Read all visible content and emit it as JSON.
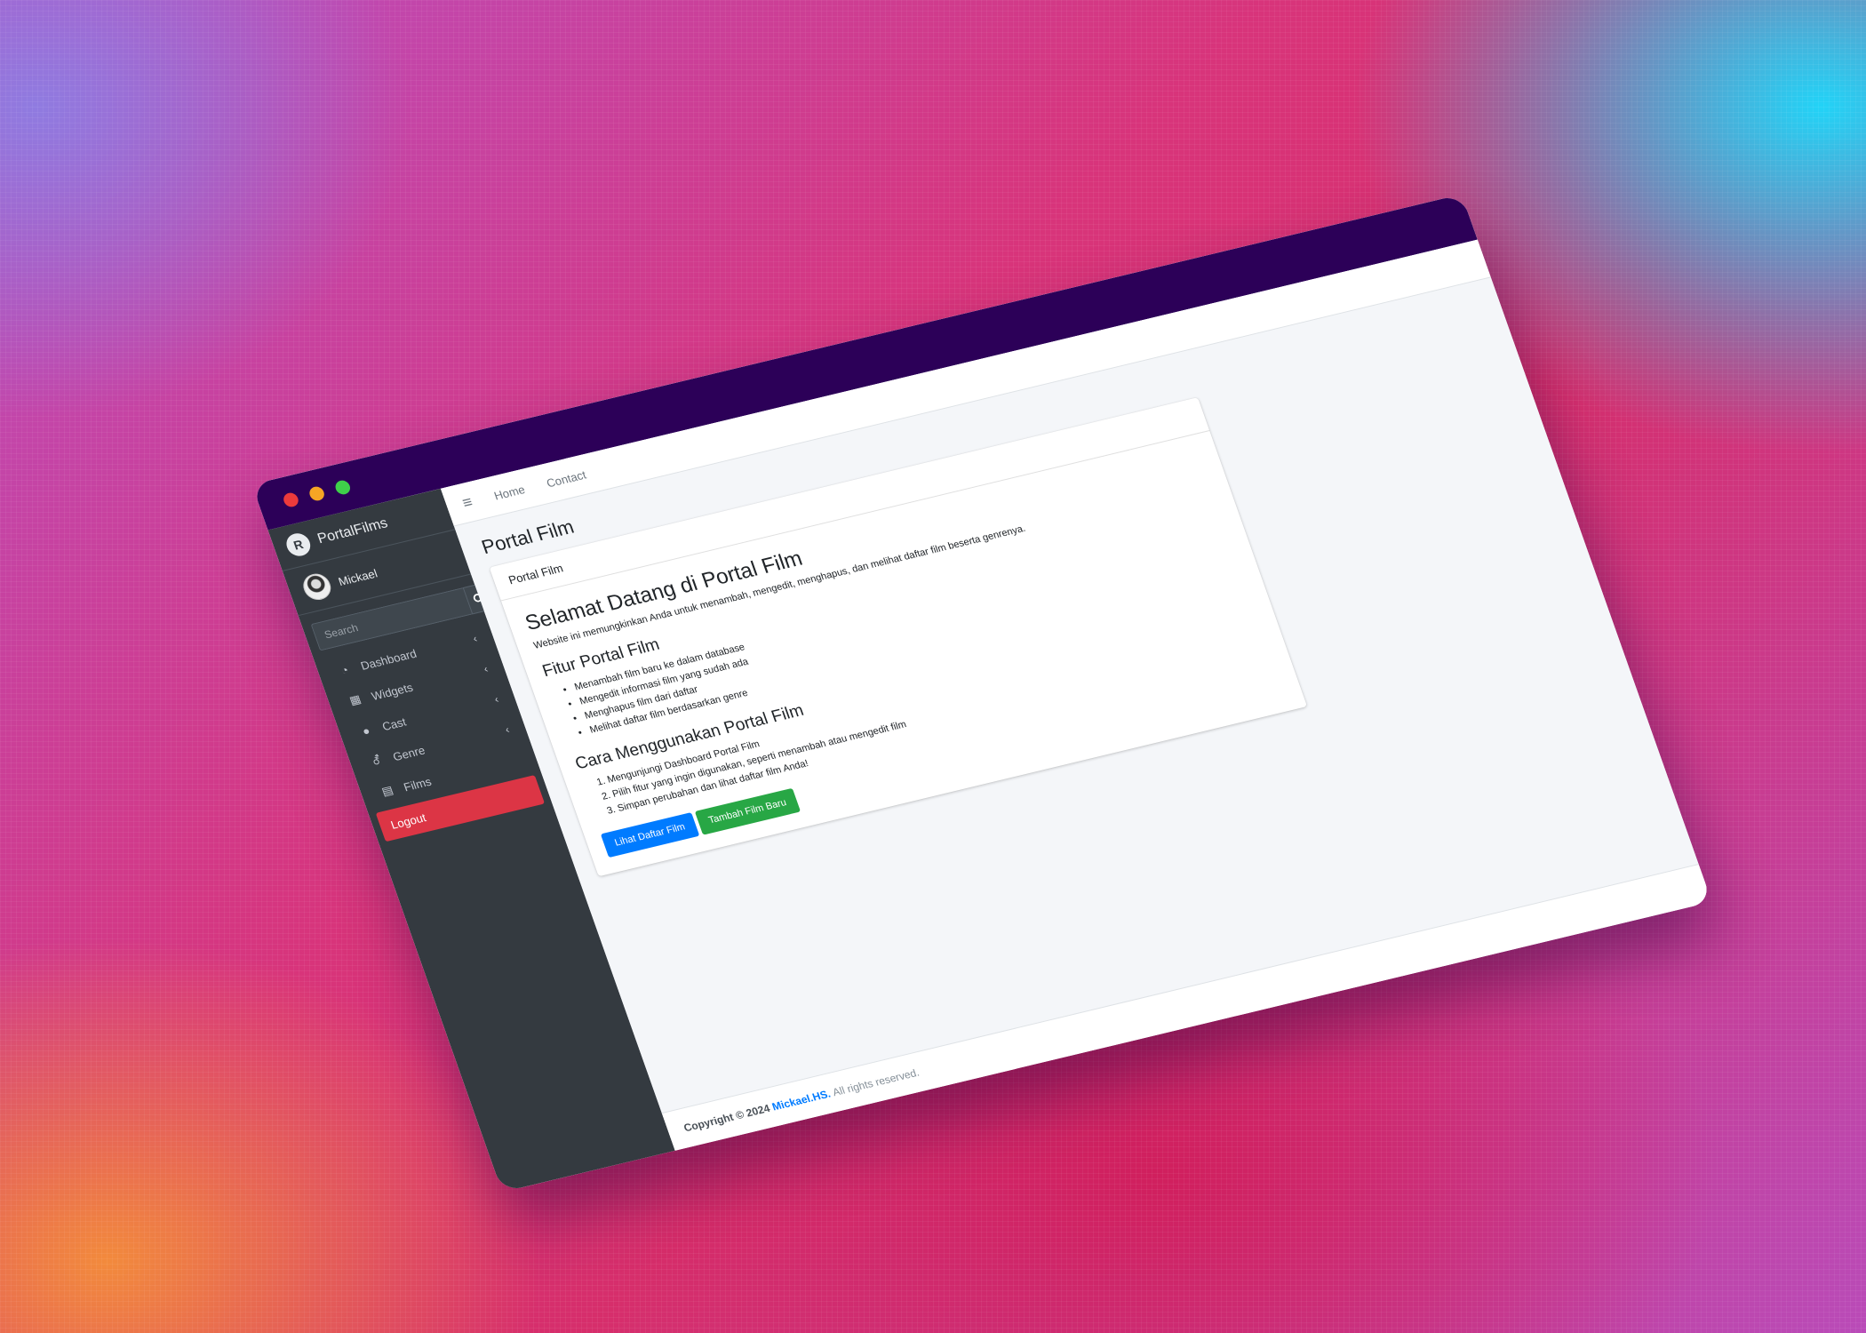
{
  "window": {
    "traffic_lights": [
      "#ec3b3b",
      "#f6a524",
      "#3fd04a"
    ],
    "titlebar_color": "#2c0058"
  },
  "sidebar": {
    "brand": "PortalFilms",
    "brand_icon": "portal-logo-icon",
    "user": {
      "name": "Mickael"
    },
    "search": {
      "placeholder": "Search"
    },
    "items": [
      {
        "label": "Dashboard",
        "icon": "tachometer-icon",
        "has_submenu": true
      },
      {
        "label": "Widgets",
        "icon": "grid-icon",
        "has_submenu": true
      },
      {
        "label": "Cast",
        "icon": "user-icon",
        "has_submenu": true
      },
      {
        "label": "Genre",
        "icon": "genderless-icon",
        "has_submenu": true
      },
      {
        "label": "Films",
        "icon": "film-icon",
        "has_submenu": false
      },
      {
        "label": "Logout",
        "icon": "",
        "has_submenu": false,
        "active": true
      }
    ]
  },
  "topnav": {
    "links": [
      "Home",
      "Contact"
    ]
  },
  "page": {
    "title": "Portal Film",
    "card_header": "Portal Film",
    "welcome_heading": "Selamat Datang di Portal Film",
    "welcome_text": "Website ini memungkinkan Anda untuk menambah, mengedit, menghapus, dan melihat daftar film beserta genrenya.",
    "features_heading": "Fitur Portal Film",
    "features": [
      "Menambah film baru ke dalam database",
      "Mengedit informasi film yang sudah ada",
      "Menghapus film dari daftar",
      "Melihat daftar film berdasarkan genre"
    ],
    "howto_heading": "Cara Menggunakan Portal Film",
    "steps": [
      "Mengunjungi Dashboard Portal Film",
      "Pilih fitur yang ingin digunakan, seperti menambah atau mengedit film",
      "Simpan perubahan dan lihat daftar film Anda!"
    ],
    "buttons": {
      "list_films": "Lihat Daftar Film",
      "add_film": "Tambah Film Baru"
    }
  },
  "footer": {
    "copyright": "Copyright © 2024",
    "owner": "Mickael.HS.",
    "rights": "All rights reserved."
  },
  "colors": {
    "sidebar_bg": "#343a40",
    "logout_bg": "#dc3545",
    "primary": "#007bff",
    "success": "#28a745"
  }
}
